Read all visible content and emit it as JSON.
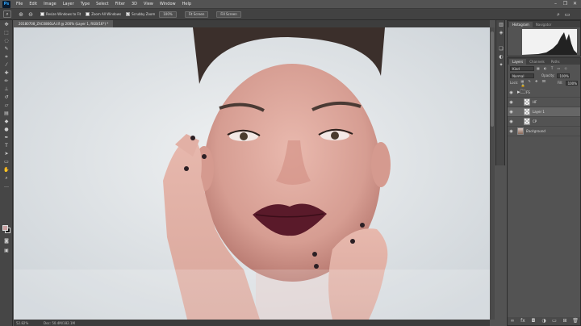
{
  "app": {
    "logo": "Ps"
  },
  "menu": [
    "File",
    "Edit",
    "Image",
    "Layer",
    "Type",
    "Select",
    "Filter",
    "3D",
    "View",
    "Window",
    "Help"
  ],
  "window_controls": [
    "–",
    "❐",
    "✕"
  ],
  "options_bar": {
    "buttons": [
      "Resize Windows to Fit",
      "Zoom All Windows",
      "Scrubby Zoom",
      "100%",
      "Fit Screen",
      "Fill Screen"
    ],
    "checkboxes": [
      {
        "label": "Resize Windows to Fit",
        "checked": false
      },
      {
        "label": "Zoom All Windows",
        "checked": false
      },
      {
        "label": "Scrubby Zoom",
        "checked": true
      }
    ],
    "plain_buttons": [
      "100%",
      "Fit Screen",
      "Fill Screen"
    ],
    "icons": [
      "zoom-in-icon",
      "zoom-out-icon"
    ]
  },
  "document": {
    "tab_title": "20180708_ZAC0866LA.tif @ 200% (Layer 1, RGB/16*) *",
    "zoom": "52.82%",
    "doc_size": "Doc: 50.4M/182.1M"
  },
  "history": {
    "tabs": [
      "History",
      "Actions"
    ],
    "items": [
      "Brush Tool",
      "Brush Tool",
      "Brush Tool",
      "Brush Tool",
      "Brush Tool",
      "Brush Tool",
      "Brush Tool",
      "Brush Tool",
      "Brush Tool",
      "Brush Tool"
    ],
    "selected_index": 9
  },
  "properties": {
    "tabs": [
      "Properties",
      "Info"
    ],
    "title": "Pixel Layer Properties",
    "w_label": "W:",
    "w_value": "906 px",
    "link_label": "GO",
    "x_label": "X:",
    "x_value": "",
    "h_label": "H:",
    "h_value": "503 px",
    "y_label": "Y:",
    "y_value": ""
  },
  "histogram": {
    "tabs": [
      "Histogram",
      "Navigator"
    ]
  },
  "layers": {
    "tabs": [
      "Layers",
      "Channels",
      "Paths"
    ],
    "kind_label": "Kind",
    "blend_mode": "Normal",
    "opacity_label": "Opacity:",
    "opacity_value": "100%",
    "lock_label": "Lock:",
    "fill_label": "Fill:",
    "fill_value": "100%",
    "rows": [
      {
        "name": "FS",
        "type": "folder",
        "visible": true,
        "selected": false,
        "indent": 0
      },
      {
        "name": "HF",
        "type": "check",
        "visible": true,
        "selected": false,
        "indent": 1
      },
      {
        "name": "Layer 1",
        "type": "check",
        "visible": true,
        "selected": true,
        "indent": 1
      },
      {
        "name": "CP",
        "type": "check",
        "visible": true,
        "selected": false,
        "indent": 1
      },
      {
        "name": "Background",
        "type": "photo",
        "visible": true,
        "selected": false,
        "indent": 0
      }
    ]
  },
  "colors": {
    "accent": "#6b7d91",
    "panel": "#535353",
    "foreground_swatch": "#c99fa0",
    "background_swatch": "#111111"
  }
}
